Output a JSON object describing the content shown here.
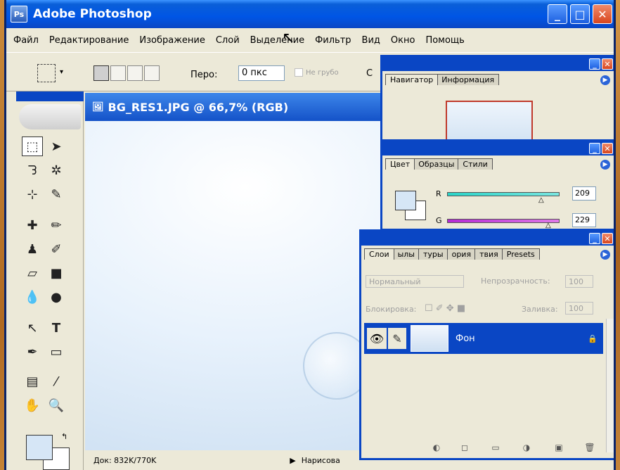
{
  "app": {
    "title": "Adobe Photoshop",
    "window_controls": {
      "minimize": "_",
      "maximize": "□",
      "close": "✕"
    }
  },
  "menubar": {
    "items": [
      "Файл",
      "Редактирование",
      "Изображение",
      "Слой",
      "Выделение",
      "Фильтр",
      "Вид",
      "Окно",
      "Помощь"
    ]
  },
  "options": {
    "feather_label": "Перо:",
    "feather_value": "0 пкс",
    "antialias_label": "Не грубо",
    "partial_label": "С"
  },
  "document": {
    "title": "BG_RES1.JPG @ 66,7% (RGB)",
    "doc_size": "Док: 832K/770K",
    "status_hint": "Нарисова"
  },
  "navigator": {
    "tabs": [
      "Навигатор",
      "Информация"
    ]
  },
  "color_palette": {
    "tabs": [
      "Цвет",
      "Образцы",
      "Стили"
    ],
    "r_label": "R",
    "r_value": "209",
    "g_label": "G",
    "g_value": "229"
  },
  "layers": {
    "tabs": [
      "Слои",
      "ылы",
      "туры",
      "ория",
      "твия",
      "Presets"
    ],
    "blend_mode": "Нормальный",
    "opacity_label": "Непрозрачность:",
    "opacity_value": "100",
    "lock_label": "Блокировка:",
    "fill_label": "Заливка:",
    "fill_value": "100",
    "layer_name": "Фон"
  },
  "colors": {
    "title_blue": "#0a46c4",
    "panel_bg": "#ece9d8",
    "foreground": "#d6e6f6",
    "background": "#ffffff"
  }
}
